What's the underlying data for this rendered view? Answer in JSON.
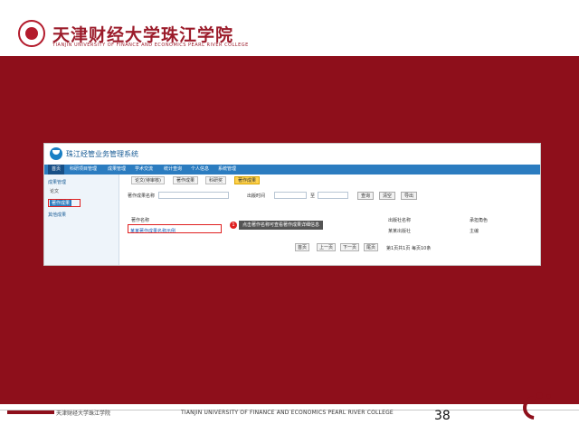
{
  "header": {
    "logo_cn": "天津财经大学珠江学院",
    "logo_en": "TIANJIN UNIVERSITY OF FINANCE AND ECONOMICS PEARL RIVER COLLEGE"
  },
  "app": {
    "name": "珠江经管业务管理系统",
    "menu": [
      "首页",
      "科研项目管理",
      "成果管理",
      "学术交流",
      "统计查询",
      "个人信息",
      "系统管理"
    ],
    "sidebar": {
      "group1": "成果管理",
      "items": [
        "论文",
        "著作成果"
      ],
      "group2": "其他成果"
    },
    "tabs": [
      "论文(待审核)",
      "著作成果",
      "科研奖",
      "著作成果"
    ],
    "form": {
      "name_label": "著作成果名称",
      "date_label": "出版时间",
      "date_sep": "至",
      "buttons": [
        "查询",
        "清空",
        "导出"
      ]
    },
    "table": {
      "headers": [
        "著作名称",
        "出版社名称",
        "承担角色"
      ],
      "row": {
        "name": "某某著作成果名称示例",
        "publisher": "某某出版社",
        "role": "主编"
      },
      "step_number": "1",
      "tooltip": "点击著作名称可查看著作成果详细信息"
    },
    "pager": {
      "items": [
        "首页",
        "上一页",
        "下一页",
        "尾页"
      ],
      "info": "第1页共1页 每页10条"
    }
  },
  "footer": {
    "cn": "天津财经大学珠江学院",
    "en": "TIANJIN UNIVERSITY OF FINANCE AND ECONOMICS PEARL RIVER COLLEGE",
    "page": "38"
  }
}
